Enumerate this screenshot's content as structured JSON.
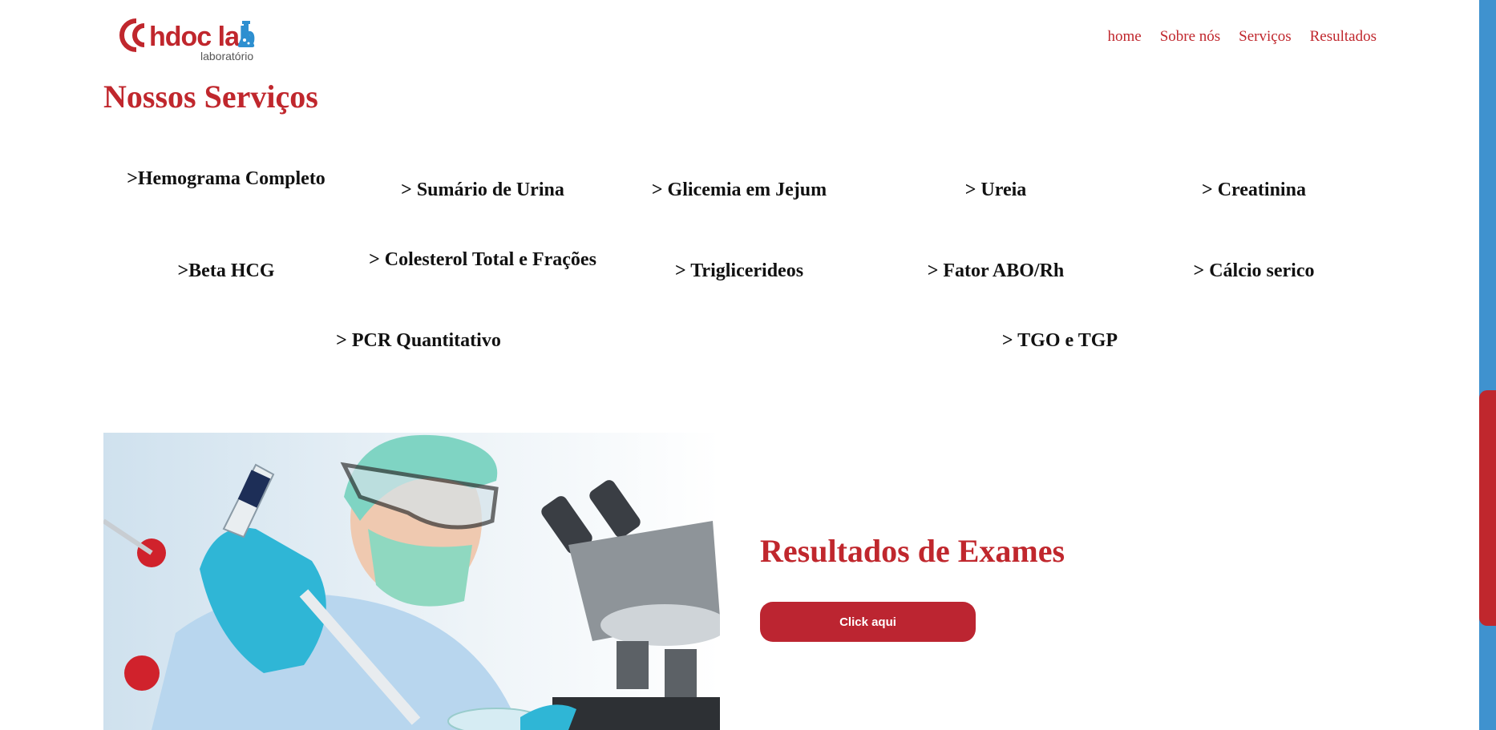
{
  "brand": {
    "name_part1": "hdoc la",
    "name_part2": "b",
    "tagline": "laboratório",
    "color_red": "#c0272d",
    "color_blue": "#2d8fd0"
  },
  "nav": {
    "items": [
      "home",
      "Sobre nós",
      "Serviços",
      "Resultados"
    ]
  },
  "services": {
    "title": "Nossos Serviços",
    "rows": [
      [
        ">Hemograma Completo",
        "> Sumário de Urina",
        "> Glicemia em Jejum",
        "> Ureia",
        "> Creatinina"
      ],
      [
        ">Beta HCG",
        "> Colesterol Total e Frações",
        "> Triglicerideos",
        "> Fator ABO/Rh",
        "> Cálcio serico"
      ],
      [
        "> PCR Quantitativo",
        "> TGO e TGP"
      ]
    ]
  },
  "results": {
    "title": "Resultados de Exames",
    "button_label": "Click aqui",
    "image_icon": "lab-technician-microscope-photo"
  },
  "colors": {
    "accent": "#c0272d",
    "button": "#bc2531",
    "scrollbar_track": "#3f92cf",
    "scrollbar_thumb": "#c0272d"
  }
}
